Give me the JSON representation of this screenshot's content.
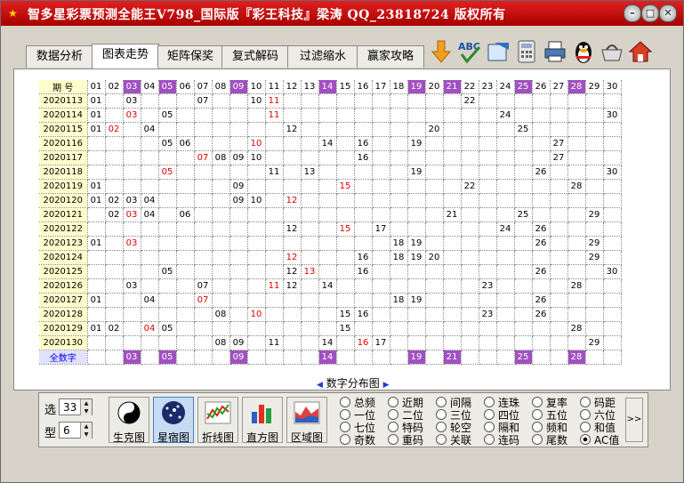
{
  "window": {
    "title": "智多星彩票预测全能王V798_国际版『彩王科技』梁涛 QQ_23818724 版权所有",
    "app_icon": "star-icon"
  },
  "tabs": [
    {
      "label": "数据分析",
      "active": false
    },
    {
      "label": "图表走势",
      "active": true
    },
    {
      "label": "矩阵保奖",
      "active": false
    },
    {
      "label": "复式解码",
      "active": false
    },
    {
      "label": "过滤缩水",
      "active": false
    },
    {
      "label": "赢家攻略",
      "active": false
    }
  ],
  "toolbar": [
    "download-arrow-icon",
    "spellcheck-abc-icon",
    "export-icon",
    "calculator-icon",
    "printer-icon",
    "qq-penguin-icon",
    "basket-icon",
    "home-icon"
  ],
  "grid": {
    "period_header": "期 号",
    "columns": [
      "01",
      "02",
      "03",
      "04",
      "05",
      "06",
      "07",
      "08",
      "09",
      "10",
      "11",
      "12",
      "13",
      "14",
      "15",
      "16",
      "17",
      "18",
      "19",
      "20",
      "21",
      "22",
      "23",
      "24",
      "25",
      "26",
      "27",
      "28",
      "29",
      "30"
    ],
    "highlight_columns": [
      "03",
      "05",
      "09",
      "14",
      "19",
      "21",
      "25",
      "28"
    ],
    "rows": [
      {
        "period": "2020113",
        "cells": {
          "01": "01",
          "03": "03",
          "07": "07",
          "10": "10",
          "11": "11",
          "22": "22"
        },
        "red": [
          "11"
        ]
      },
      {
        "period": "2020114",
        "cells": {
          "01": "01",
          "03": "03",
          "05": "05",
          "11": "11",
          "24": "24",
          "30": "30"
        },
        "red": [
          "03",
          "11"
        ]
      },
      {
        "period": "2020115",
        "cells": {
          "01": "01",
          "02": "02",
          "04": "04",
          "12": "12",
          "20": "20",
          "25": "25"
        },
        "red": [
          "02"
        ]
      },
      {
        "period": "2020116",
        "cells": {
          "05": "05",
          "06": "06",
          "10": "10",
          "14": "14",
          "16": "16",
          "19": "19",
          "27": "27"
        },
        "red": [
          "10"
        ]
      },
      {
        "period": "2020117",
        "cells": {
          "07": "07",
          "08": "08",
          "09": "09",
          "10": "10",
          "16": "16",
          "27": "27"
        },
        "red": [
          "07"
        ]
      },
      {
        "period": "2020118",
        "cells": {
          "05": "05",
          "11": "11",
          "13": "13",
          "19": "19",
          "26": "26",
          "30": "30"
        },
        "red": [
          "05"
        ]
      },
      {
        "period": "2020119",
        "cells": {
          "01": "01",
          "09": "09",
          "15": "15",
          "22": "22",
          "28": "28"
        },
        "red": [
          "15"
        ]
      },
      {
        "period": "2020120",
        "cells": {
          "01": "01",
          "02": "02",
          "03": "03",
          "04": "04",
          "09": "09",
          "10": "10",
          "12": "12"
        },
        "red": [
          "12"
        ]
      },
      {
        "period": "2020121",
        "cells": {
          "02": "02",
          "03": "03",
          "04": "04",
          "06": "06",
          "21": "21",
          "25": "25",
          "29": "29"
        },
        "red": [
          "03"
        ]
      },
      {
        "period": "2020122",
        "cells": {
          "12": "12",
          "15": "15",
          "17": "17",
          "24": "24",
          "26": "26"
        },
        "red": [
          "15"
        ]
      },
      {
        "period": "2020123",
        "cells": {
          "01": "01",
          "03": "03",
          "18": "18",
          "19": "19",
          "26": "26",
          "29": "29"
        },
        "red": [
          "03"
        ]
      },
      {
        "period": "2020124",
        "cells": {
          "12": "12",
          "16": "16",
          "18": "18",
          "19": "19",
          "20": "20",
          "29": "29"
        },
        "red": [
          "12"
        ]
      },
      {
        "period": "2020125",
        "cells": {
          "05": "05",
          "12": "12",
          "13": "13",
          "16": "16",
          "26": "26",
          "30": "30"
        },
        "red": [
          "13"
        ]
      },
      {
        "period": "2020126",
        "cells": {
          "03": "03",
          "07": "07",
          "11": "11",
          "12": "12",
          "14": "14",
          "23": "23",
          "28": "28"
        },
        "red": [
          "11"
        ]
      },
      {
        "period": "2020127",
        "cells": {
          "01": "01",
          "04": "04",
          "07": "07",
          "18": "18",
          "19": "19",
          "26": "26"
        },
        "red": [
          "07"
        ]
      },
      {
        "period": "2020128",
        "cells": {
          "08": "08",
          "10": "10",
          "15": "15",
          "16": "16",
          "23": "23",
          "26": "26"
        },
        "red": [
          "10"
        ]
      },
      {
        "period": "2020129",
        "cells": {
          "01": "01",
          "02": "02",
          "04": "04",
          "05": "05",
          "15": "15",
          "28": "28"
        },
        "red": [
          "04"
        ]
      },
      {
        "period": "2020130",
        "cells": {
          "08": "08",
          "09": "09",
          "11": "11",
          "14": "14",
          "16": "16",
          "17": "17",
          "29": "29"
        },
        "red": [
          "16"
        ]
      }
    ],
    "summary_label": "全数字",
    "summary_cells": [
      "03",
      "05",
      "09",
      "14",
      "19",
      "21",
      "25",
      "28"
    ]
  },
  "caption": "数字分布图",
  "controls": {
    "select_label": "选",
    "select_value": "33",
    "type_label": "型",
    "type_value": "6"
  },
  "chart_buttons": [
    {
      "label": "生克图",
      "icon": "yin-yang-icon",
      "active": false
    },
    {
      "label": "星宿图",
      "icon": "star-constellation-icon",
      "active": true
    },
    {
      "label": "折线图",
      "icon": "line-chart-icon",
      "active": false
    },
    {
      "label": "直方图",
      "icon": "bar-chart-icon",
      "active": false
    },
    {
      "label": "区域图",
      "icon": "area-chart-icon",
      "active": false
    }
  ],
  "radios": [
    [
      "总频",
      "近期",
      "间隔",
      "连珠",
      "复率",
      "码距"
    ],
    [
      "一位",
      "二位",
      "三位",
      "四位",
      "五位",
      "六位"
    ],
    [
      "七位",
      "特码",
      "轮空",
      "隔和",
      "频和",
      "和值"
    ],
    [
      "奇数",
      "重码",
      "关联",
      "连码",
      "尾数",
      "AC值"
    ]
  ],
  "radio_selected": "AC值",
  "more_button": ">>"
}
